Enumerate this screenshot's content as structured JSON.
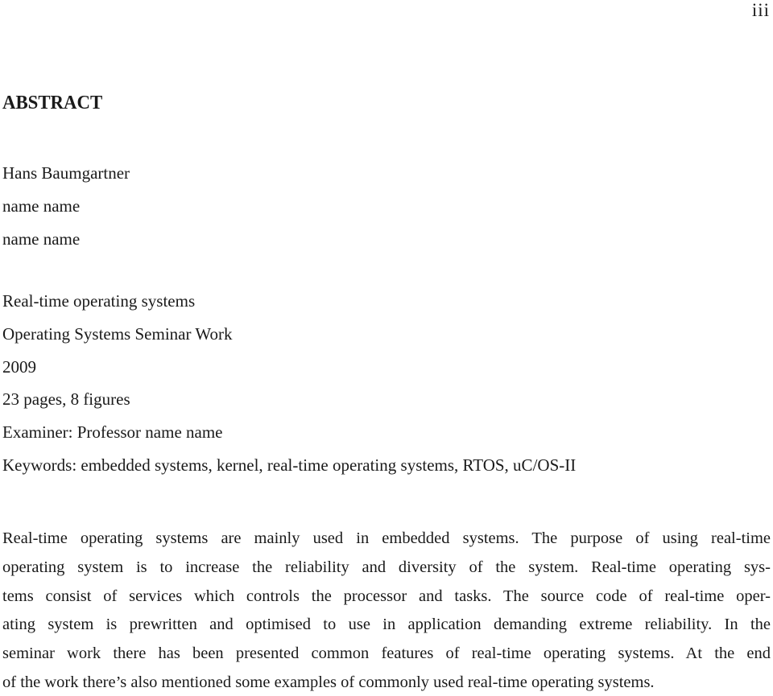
{
  "page": {
    "number": "iii"
  },
  "abstract": {
    "heading": "ABSTRACT",
    "author": "Hans Baumgartner",
    "affiliation_lines": [
      "name name",
      "name name"
    ],
    "title": "Real-time operating systems",
    "work_type": "Operating Systems Seminar Work",
    "year": "2009",
    "extent": "23 pages, 8 figures",
    "examiner": "Examiner: Professor name name",
    "keywords": "Keywords: embedded systems, kernel, real-time operating systems, RTOS, uC/OS-II",
    "body_lines": [
      "Real-time operating systems are mainly used in embedded systems. The purpose of using real-time",
      "operating system is to increase the reliability and diversity of the system. Real-time operating sys-",
      "tems consist of services which controls the processor and tasks. The source code of real-time oper-",
      "ating system is prewritten and optimised to use in application demanding extreme reliability. In the",
      "seminar work there has been presented common features of real-time operating systems. At the end",
      "of the work there’s also mentioned some examples of commonly used real-time operating systems."
    ]
  }
}
